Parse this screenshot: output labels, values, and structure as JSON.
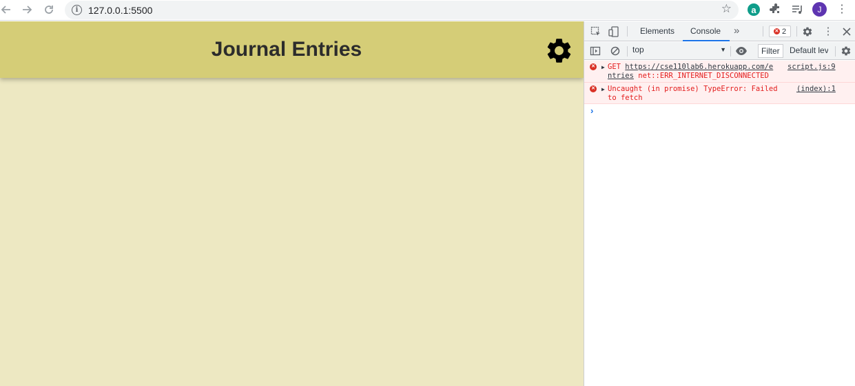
{
  "browser": {
    "url": "127.0.0.1:5500",
    "avatar_letter": "J",
    "extension_letter": "a"
  },
  "page": {
    "title": "Journal Entries",
    "header_color": "#d5cd77",
    "background_color": "#ede8c2"
  },
  "devtools": {
    "tabs": [
      {
        "label": "Elements",
        "active": false
      },
      {
        "label": "Console",
        "active": true
      }
    ],
    "error_count": "2",
    "context": "top",
    "filter_placeholder": "Filter",
    "levels_label": "Default lev",
    "messages": [
      {
        "prefix": "GET ",
        "url_line1": "https://cse110lab6.herokuapp.com/e",
        "url_line2": "ntries",
        "suffix": " net::ERR_INTERNET_DISCONNECTED",
        "source": "script.js:9"
      },
      {
        "line1": "Uncaught (in promise) TypeError: Failed",
        "line2": "to fetch",
        "source": "(index):1"
      }
    ],
    "prompt_symbol": "›"
  }
}
